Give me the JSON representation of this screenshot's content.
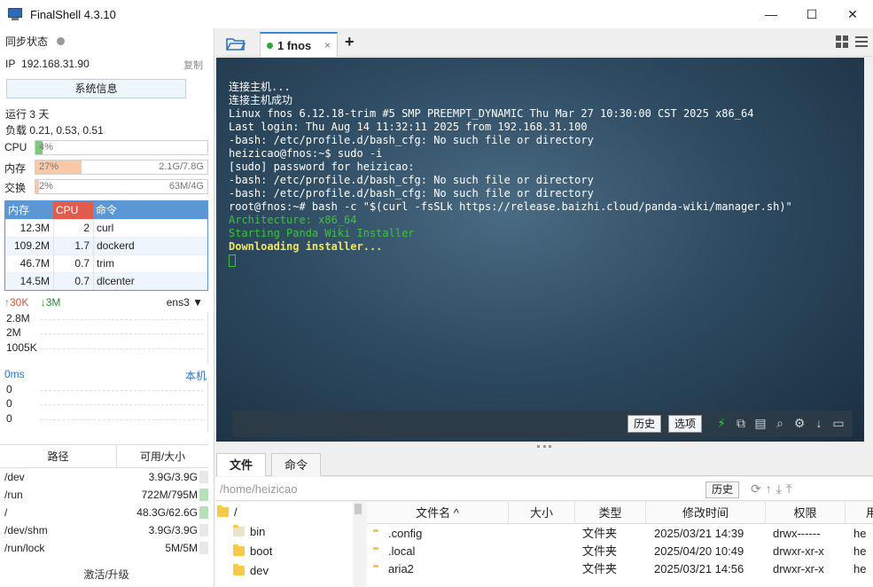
{
  "window": {
    "title": "FinalShell 4.3.10",
    "controls": {
      "minimize": "—",
      "maximize": "☐",
      "close": "✕"
    }
  },
  "left": {
    "sync_status": "同步状态",
    "ip_label": "IP",
    "ip_value": "192.168.31.90",
    "copy": "复制",
    "sysinfo_button": "系统信息",
    "uptime": "运行 3 天",
    "load": "负载 0.21, 0.53, 0.51",
    "meters": [
      {
        "label": "CPU",
        "pct": "4%",
        "fraction": 0.04,
        "right": "",
        "color": "#7fc97f"
      },
      {
        "label": "内存",
        "pct": "27%",
        "fraction": 0.27,
        "right": "2.1G/7.8G",
        "color": "#f9c8a6"
      },
      {
        "label": "交换",
        "pct": "2%",
        "fraction": 0.02,
        "right": "63M/4G",
        "color": "#f9c8a6"
      }
    ],
    "process_headers": {
      "mem": "内存",
      "cpu": "CPU",
      "cmd": "命令"
    },
    "processes": [
      {
        "mem": "12.3M",
        "cpu": "2",
        "cmd": "curl"
      },
      {
        "mem": "109.2M",
        "cpu": "1.7",
        "cmd": "dockerd"
      },
      {
        "mem": "46.7M",
        "cpu": "0.7",
        "cmd": "trim"
      },
      {
        "mem": "14.5M",
        "cpu": "0.7",
        "cmd": "dlcenter"
      }
    ],
    "net": {
      "up": "30K",
      "down": "3M",
      "iface": "ens3",
      "labels": [
        "2.8M",
        "2M",
        "1005K"
      ]
    },
    "latency": {
      "title": "0ms",
      "host": "本机",
      "labels": [
        "0",
        "0",
        "0"
      ]
    },
    "disk_headers": {
      "path": "路径",
      "size": "可用/大小"
    },
    "disks": [
      {
        "path": "/dev",
        "size": "3.9G/3.9G"
      },
      {
        "path": "/run",
        "size": "722M/795M"
      },
      {
        "path": "/",
        "size": "48.3G/62.6G"
      },
      {
        "path": "/dev/shm",
        "size": "3.9G/3.9G"
      },
      {
        "path": "/run/lock",
        "size": "5M/5M"
      }
    ],
    "upgrade": "激活/升级"
  },
  "tabs": {
    "active_tab": "1 fnos",
    "close": "×",
    "add": "+"
  },
  "terminal": {
    "lines": [
      {
        "text": "连接主机...",
        "style": "normal"
      },
      {
        "text": "连接主机成功",
        "style": "normal"
      },
      {
        "text": "Linux fnos 6.12.18-trim #5 SMP PREEMPT_DYNAMIC Thu Mar 27 10:30:00 CST 2025 x86_64",
        "style": "normal"
      },
      {
        "text": "Last login: Thu Aug 14 11:32:11 2025 from 192.168.31.100",
        "style": "normal"
      },
      {
        "text": "-bash: /etc/profile.d/bash_cfg: No such file or directory",
        "style": "normal"
      },
      {
        "text": "heizicao@fnos:~$ sudo -i",
        "style": "normal"
      },
      {
        "text": "[sudo] password for heizicao:",
        "style": "normal"
      },
      {
        "text": "-bash: /etc/profile.d/bash_cfg: No such file or directory",
        "style": "normal"
      },
      {
        "text": "-bash: /etc/profile.d/bash_cfg: No such file or directory",
        "style": "normal"
      },
      {
        "text": "root@fnos:~# bash -c \"$(curl -fsSLk https://release.baizhi.cloud/panda-wiki/manager.sh)\"",
        "style": "normal"
      },
      {
        "text": "Architecture: x86_64",
        "style": "green"
      },
      {
        "text": "Starting Panda Wiki Installer",
        "style": "green"
      },
      {
        "text": "Downloading installer...",
        "style": "yellow"
      }
    ],
    "toolbar": {
      "history": "历史",
      "options": "选项"
    }
  },
  "files": {
    "tabs": [
      "文件",
      "命令"
    ],
    "path": "/home/heizicao",
    "history": "历史",
    "tree": [
      {
        "name": "/",
        "level": 0
      },
      {
        "name": "bin",
        "level": 1
      },
      {
        "name": "boot",
        "level": 1
      },
      {
        "name": "dev",
        "level": 1
      }
    ],
    "columns": [
      "文件名 ^",
      "大小",
      "类型",
      "修改时间",
      "权限",
      "用"
    ],
    "rows": [
      {
        "name": ".config",
        "size": "",
        "type": "文件夹",
        "mtime": "2025/03/21 14:39",
        "perm": "drwx------",
        "owner": "he"
      },
      {
        "name": ".local",
        "size": "",
        "type": "文件夹",
        "mtime": "2025/04/20 10:49",
        "perm": "drwxr-xr-x",
        "owner": "he"
      },
      {
        "name": "aria2",
        "size": "",
        "type": "文件夹",
        "mtime": "2025/03/21 14:56",
        "perm": "drwxr-xr-x",
        "owner": "he"
      }
    ]
  }
}
